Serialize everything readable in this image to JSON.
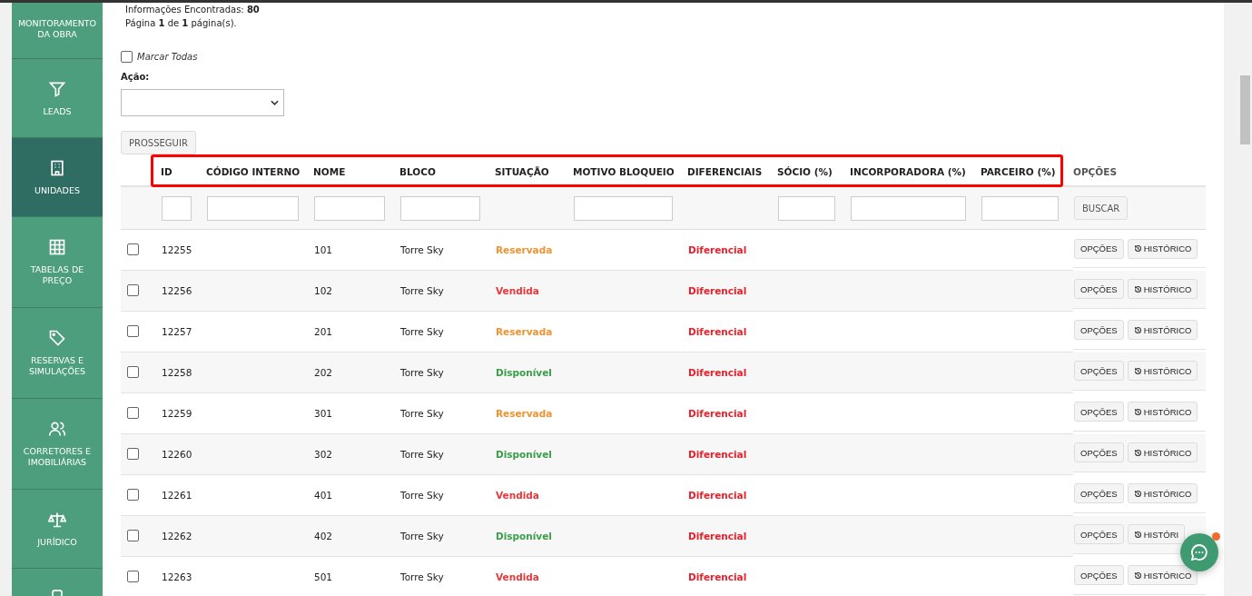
{
  "sidebar": {
    "items": [
      {
        "label": "MONITORAMENTO DA OBRA",
        "selected": false
      },
      {
        "label": "LEADS",
        "selected": false
      },
      {
        "label": "UNIDADES",
        "selected": true
      },
      {
        "label": "TABELAS DE PREÇO",
        "selected": false
      },
      {
        "label": "RESERVAS E SIMULAÇÕES",
        "selected": false
      },
      {
        "label": "CORRETORES E IMOBILIÁRIAS",
        "selected": false
      },
      {
        "label": "JURÍDICO",
        "selected": false
      },
      {
        "selected": false
      }
    ]
  },
  "summary": {
    "found_label": "Informações Encontradas:",
    "found_count": "80",
    "page_text": "Página **1** de **1** página(s)."
  },
  "select_all": {
    "label": "Marcar Todas",
    "checked": false
  },
  "action": {
    "label": "Ação:"
  },
  "proceed_button": "PROSSEGUIR",
  "table": {
    "columns": [
      {
        "label": "ID",
        "filter": true
      },
      {
        "label": "CÓDIGO INTERNO",
        "filter": true
      },
      {
        "label": "NOME",
        "filter": true
      },
      {
        "label": "BLOCO",
        "filter": true
      },
      {
        "label": "SITUAÇÃO",
        "filter": false
      },
      {
        "label": "MOTIVO BLOQUEIO",
        "filter": true
      },
      {
        "label": "DIFERENCIAIS",
        "filter": false
      },
      {
        "label": "SÓCIO (%)",
        "filter": true
      },
      {
        "label": "INCORPORADORA (%)",
        "filter": true
      },
      {
        "label": "PARCEIRO (%)",
        "filter": true
      },
      {
        "label": "OPÇÕES"
      }
    ],
    "search_button": "BUSCAR",
    "rows": [
      {
        "checked": false,
        "id": "12255",
        "name": "101",
        "block": "Torre Sky",
        "status": "Reservada",
        "color": "#f0922e",
        "features": "Diferencial",
        "options": "OPÇÕES",
        "history": "HISTÓRICO"
      },
      {
        "checked": false,
        "id": "12256",
        "name": "102",
        "block": "Torre Sky",
        "status": "Vendida",
        "color": "#e8383b",
        "features": "Diferencial",
        "options": "OPÇÕES",
        "history": "HISTÓRICO"
      },
      {
        "checked": false,
        "id": "12257",
        "name": "201",
        "block": "Torre Sky",
        "status": "Reservada",
        "color": "#f0922e",
        "features": "Diferencial",
        "options": "OPÇÕES",
        "history": "HISTÓRICO"
      },
      {
        "checked": false,
        "id": "12258",
        "name": "202",
        "block": "Torre Sky",
        "status": "Disponível",
        "color": "#3a9d48",
        "features": "Diferencial",
        "options": "OPÇÕES",
        "history": "HISTÓRICO"
      },
      {
        "checked": false,
        "id": "12259",
        "name": "301",
        "block": "Torre Sky",
        "status": "Reservada",
        "color": "#f0922e",
        "features": "Diferencial",
        "options": "OPÇÕES",
        "history": "HISTÓRICO"
      },
      {
        "checked": false,
        "id": "12260",
        "name": "302",
        "block": "Torre Sky",
        "status": "Disponível",
        "color": "#3a9d48",
        "features": "Diferencial",
        "options": "OPÇÕES",
        "history": "HISTÓRICO"
      },
      {
        "checked": false,
        "id": "12261",
        "name": "401",
        "block": "Torre Sky",
        "status": "Vendida",
        "color": "#e8383b",
        "features": "Diferencial",
        "options": "OPÇÕES",
        "history": "HISTÓRICO"
      },
      {
        "checked": false,
        "id": "12262",
        "name": "402",
        "block": "Torre Sky",
        "status": "Disponível",
        "color": "#3a9d48",
        "features": "Diferencial",
        "options": "OPÇÕES",
        "history": "HISTÓRI"
      },
      {
        "checked": false,
        "id": "12263",
        "name": "501",
        "block": "Torre Sky",
        "status": "Vendida",
        "color": "#e8383b",
        "features": "Diferencial",
        "options": "OPÇÕES",
        "history": "HISTÓRICO"
      }
    ]
  },
  "chat": {
    "unread": true
  }
}
